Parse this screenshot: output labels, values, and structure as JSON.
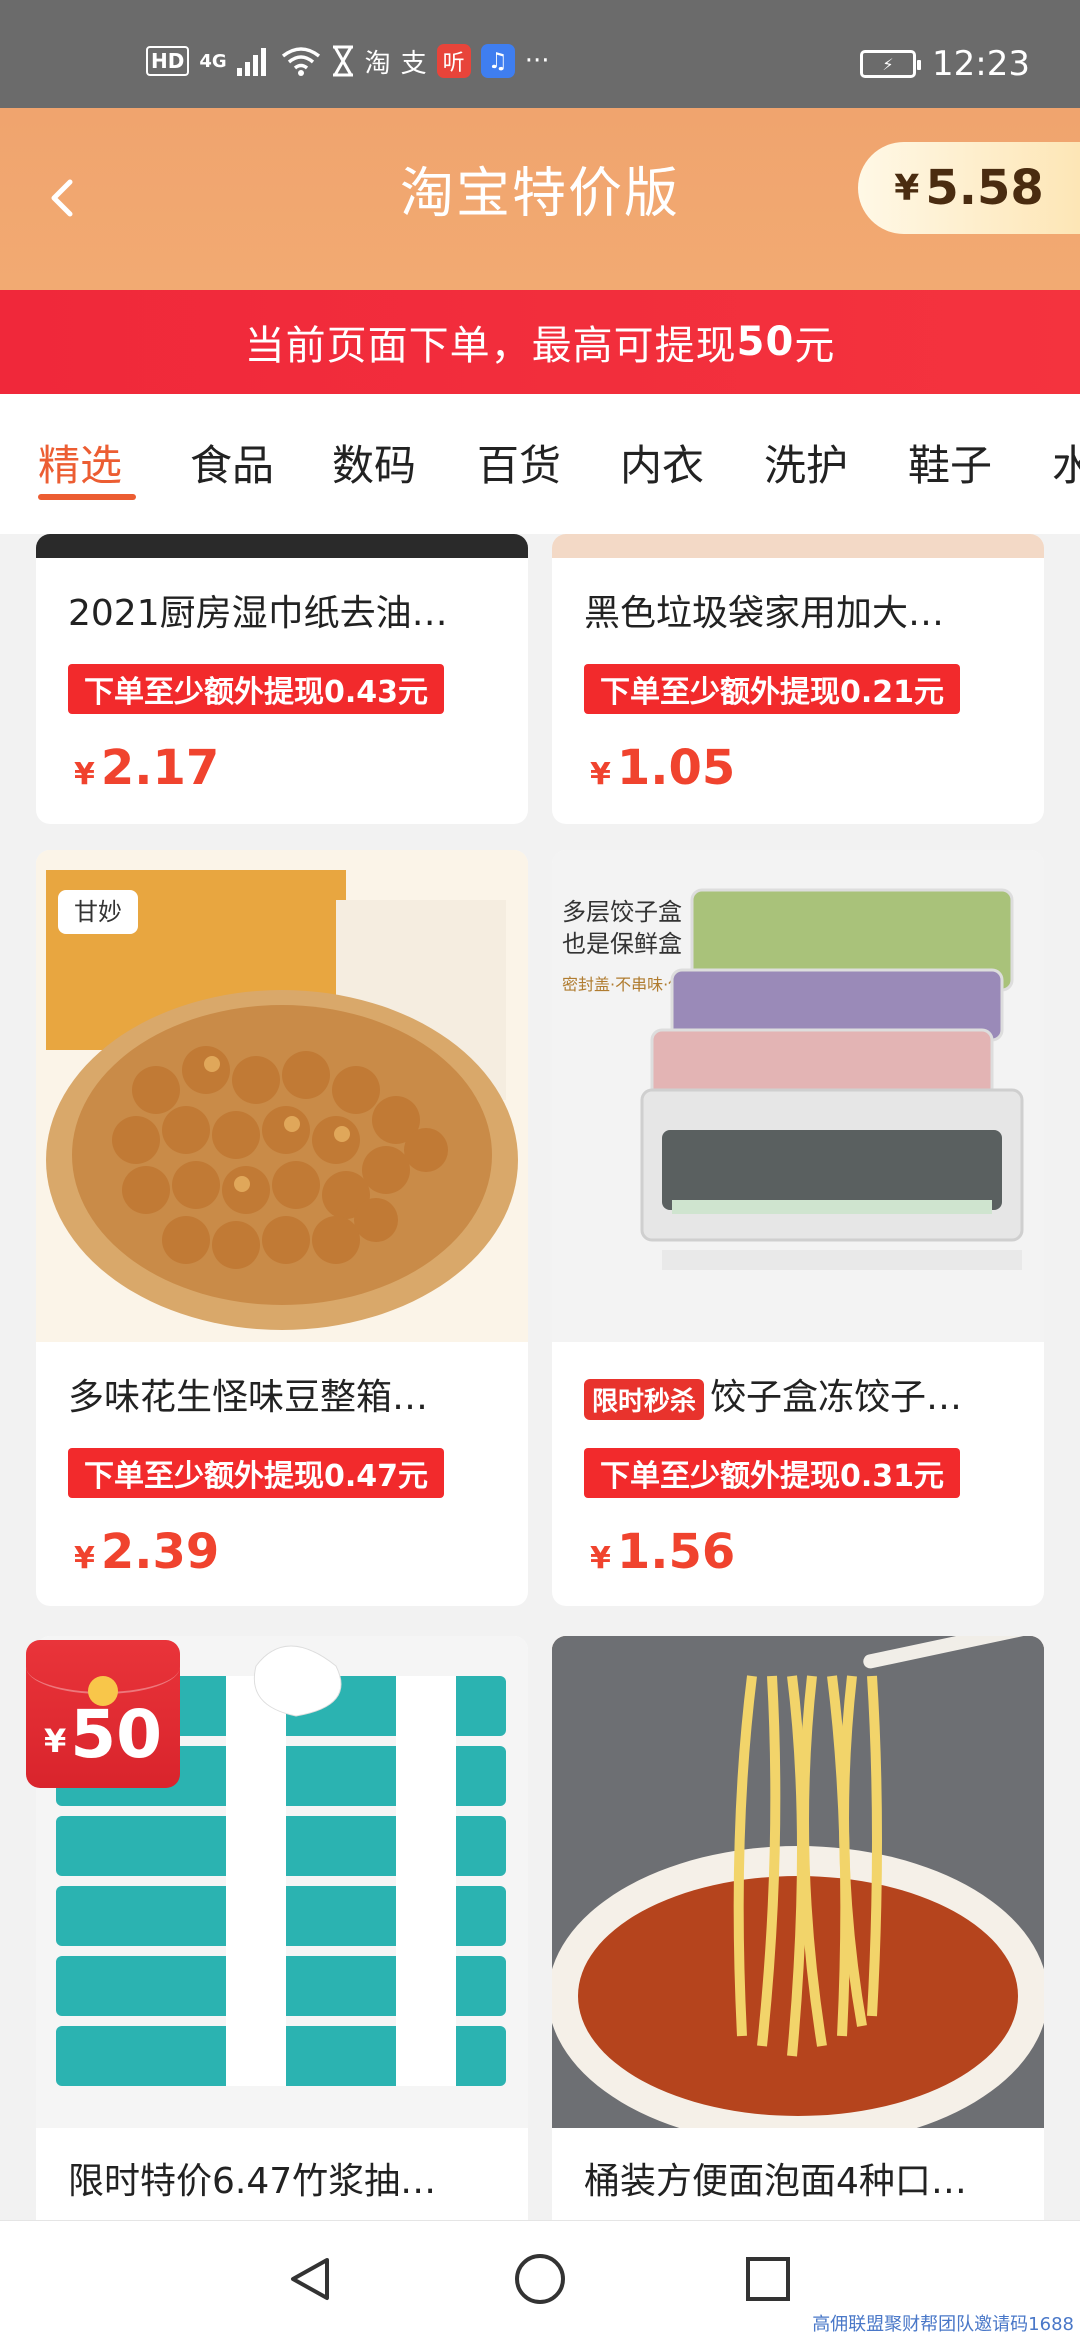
{
  "status_bar": {
    "hd": "HD",
    "signal": "4G",
    "app1": "淘",
    "app2": "支",
    "app3": "听",
    "more": "···",
    "time": "12:23"
  },
  "header": {
    "title": "淘宝特价版",
    "balance_currency": "¥",
    "balance": "5.58"
  },
  "banner": {
    "text_prefix": "当前页面下单，最高可提现",
    "amount": "50",
    "text_suffix": "元"
  },
  "tabs": [
    {
      "label": "精选",
      "active": true
    },
    {
      "label": "食品"
    },
    {
      "label": "数码"
    },
    {
      "label": "百货"
    },
    {
      "label": "内衣"
    },
    {
      "label": "洗护"
    },
    {
      "label": "鞋子"
    },
    {
      "label": "水"
    }
  ],
  "products": [
    {
      "name": "2021厨房湿巾纸去油…",
      "tag": "下单至少额外提现0.43元",
      "currency": "¥",
      "price": "2.17"
    },
    {
      "name": "黑色垃圾袋家用加大…",
      "tag": "下单至少额外提现0.21元",
      "currency": "¥",
      "price": "1.05"
    },
    {
      "name": "多味花生怪味豆整箱…",
      "tag": "下单至少额外提现0.47元",
      "currency": "¥",
      "price": "2.39",
      "image_text": "甘妙"
    },
    {
      "name": "饺子盒冻饺子…",
      "badge": "限时秒杀",
      "tag": "下单至少额外提现0.31元",
      "currency": "¥",
      "price": "1.56",
      "image_text1": "多层饺子盒",
      "image_text2": "也是保鲜盒",
      "image_text3": "密封盖·不串味·保新鲜"
    },
    {
      "name": "限时特价6.47竹浆抽…",
      "coupon_currency": "¥",
      "coupon_amount": "50"
    },
    {
      "name": "桶装方便面泡面4种口…"
    }
  ],
  "watermark": "高佣联盟聚财帮团队邀请码1688",
  "colors": {
    "accent": "#ec5d32",
    "banner_red": "#f22a2c",
    "price_red": "#f0432e",
    "header_orange": "#f2aa72"
  }
}
